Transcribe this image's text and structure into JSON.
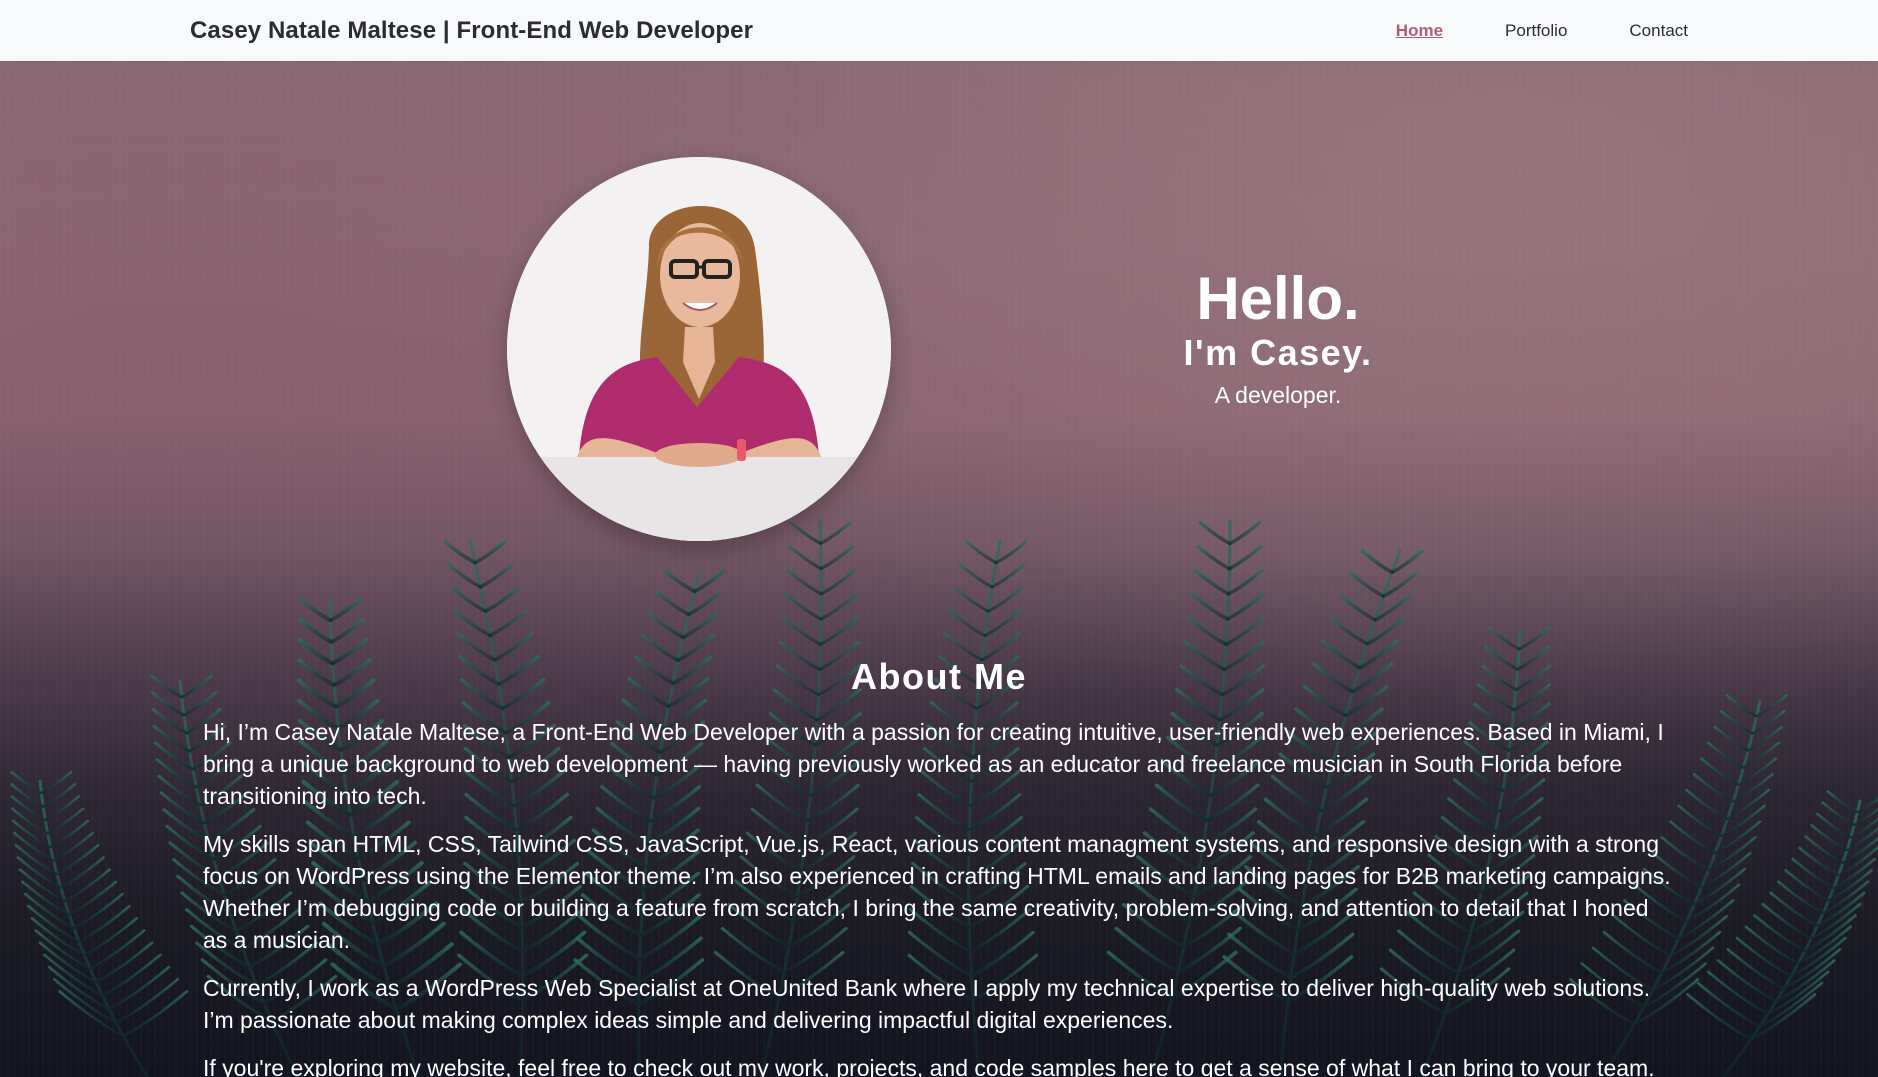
{
  "nav": {
    "brand": "Casey Natale Maltese | Front-End Web Developer",
    "links": [
      "Home",
      "Portfolio",
      "Contact"
    ],
    "active": "Home"
  },
  "hero": {
    "hello": "Hello.",
    "name": "I'm Casey.",
    "role": "A developer."
  },
  "about": {
    "title": "About Me",
    "p1": "Hi, I’m Casey Natale Maltese, a Front-End Web Developer with a passion for creating intuitive, user-friendly web experiences. Based in Miami, I bring a unique background to web development — having previously worked as an educator and freelance musician in South Florida before transitioning into tech.",
    "p2": "My skills span HTML, CSS, Tailwind CSS, JavaScript, Vue.js, React, various content managment systems, and responsive design with a strong focus on WordPress using the Elementor theme. I’m also experienced in crafting HTML emails and landing pages for B2B marketing campaigns. Whether I’m debugging code or building a feature from scratch, I bring the same creativity, problem-solving, and attention to detail that I honed as a musician.",
    "p3": "Currently, I work as a WordPress Web Specialist at OneUnited Bank where I apply my technical expertise to deliver high-quality web solutions. I’m passionate about making complex ideas simple and delivering impactful digital experiences.",
    "p4_before": "If you're exploring my website, feel free to check out my work, projects, and code samples ",
    "p4_link": "here",
    "p4_after": " to get a sense of what I can bring to your team."
  },
  "colors": {
    "accent": "#b35d75",
    "nav_bg": "#f8f9fa",
    "top_background": "#8a6873",
    "shirt": "#b02a6e"
  },
  "icons": [
    "profile-photo"
  ]
}
